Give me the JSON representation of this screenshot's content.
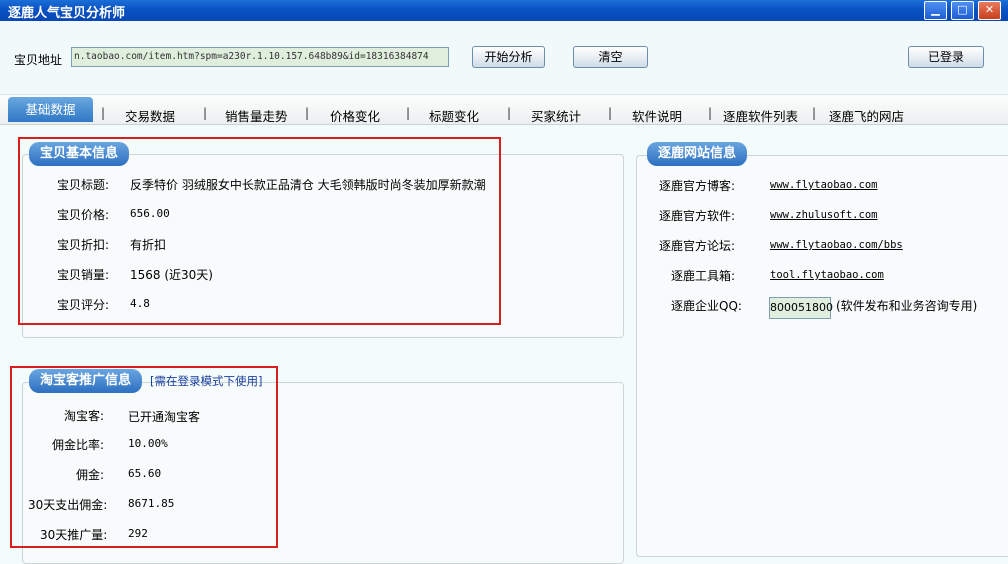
{
  "window": {
    "title": "逐鹿人气宝贝分析师",
    "minimize": "▁",
    "maximize": "□",
    "close": "✕"
  },
  "toolbar": {
    "url_label": "宝贝地址",
    "url_value": "n.taobao.com/item.htm?spm=a230r.1.10.157.648b89&id=18316384874",
    "analyze_button": "开始分析",
    "clear_button": "清空",
    "login_button": "已登录"
  },
  "tabs": [
    {
      "label": "基础数据",
      "active": true
    },
    {
      "label": "交易数据"
    },
    {
      "label": "销售量走势"
    },
    {
      "label": "价格变化"
    },
    {
      "label": "标题变化"
    },
    {
      "label": "买家统计"
    },
    {
      "label": "软件说明"
    },
    {
      "label": "逐鹿软件列表"
    },
    {
      "label": "逐鹿飞的网店"
    }
  ],
  "basic_info": {
    "title": "宝贝基本信息",
    "fields": [
      {
        "label": "宝贝标题:",
        "value": "反季特价 羽绒服女中长款正品清仓 大毛领韩版时尚冬装加厚新款潮"
      },
      {
        "label": "宝贝价格:",
        "value": "656.00"
      },
      {
        "label": "宝贝折扣:",
        "value": "有折扣"
      },
      {
        "label": "宝贝销量:",
        "value": "1568 (近30天)"
      },
      {
        "label": "宝贝评分:",
        "value": "4.8"
      }
    ]
  },
  "promo_info": {
    "title": "淘宝客推广信息",
    "note": "[需在登录模式下使用]",
    "fields": [
      {
        "label": "淘宝客:",
        "value": "已开通淘宝客"
      },
      {
        "label": "佣金比率:",
        "value": "10.00%"
      },
      {
        "label": "佣金:",
        "value": "65.60"
      },
      {
        "label": "30天支出佣金:",
        "value": "8671.85"
      },
      {
        "label": "30天推广量:",
        "value": "292"
      }
    ]
  },
  "site_info": {
    "title": "逐鹿网站信息",
    "links": [
      {
        "label": "逐鹿官方博客:",
        "value": "www.flytaobao.com"
      },
      {
        "label": "逐鹿官方软件:",
        "value": "www.zhulusoft.com"
      },
      {
        "label": "逐鹿官方论坛:",
        "value": "www.flytaobao.com/bbs"
      },
      {
        "label": "逐鹿工具箱:",
        "value": "tool.flytaobao.com"
      }
    ],
    "qq_label": "逐鹿企业QQ:",
    "qq_value": "800051800",
    "qq_note": "(软件发布和业务咨询专用)"
  }
}
